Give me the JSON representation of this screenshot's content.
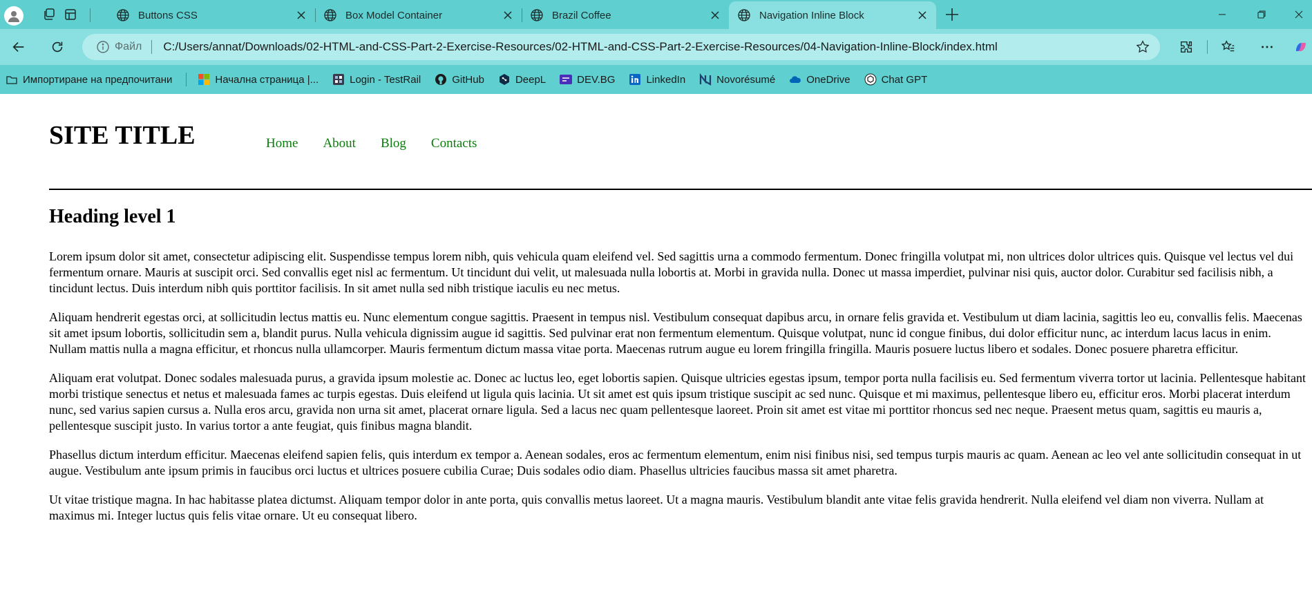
{
  "browser": {
    "tabs": [
      {
        "title": "Buttons CSS",
        "active": false
      },
      {
        "title": "Box Model Container",
        "active": false
      },
      {
        "title": "Brazil Coffee",
        "active": false
      },
      {
        "title": "Navigation Inline Block",
        "active": true
      }
    ],
    "address": {
      "file_label": "Файл",
      "url": "C:/Users/annat/Downloads/02-HTML-and-CSS-Part-2-Exercise-Resources/02-HTML-and-CSS-Part-2-Exercise-Resources/04-Navigation-Inline-Block/index.html"
    },
    "bookmarks": [
      {
        "label": "Импортиране на предпочитани",
        "icon": "folder-icon"
      },
      {
        "label": "Начална страница |...",
        "icon": "windows-icon"
      },
      {
        "label": "Login - TestRail",
        "icon": "testrail-icon"
      },
      {
        "label": "GitHub",
        "icon": "github-icon"
      },
      {
        "label": "DeepL",
        "icon": "deepl-icon"
      },
      {
        "label": "DEV.BG",
        "icon": "devbg-icon"
      },
      {
        "label": "LinkedIn",
        "icon": "linkedin-icon"
      },
      {
        "label": "Novorésumé",
        "icon": "novoresume-icon"
      },
      {
        "label": "OneDrive",
        "icon": "onedrive-icon"
      },
      {
        "label": "Chat GPT",
        "icon": "chatgpt-icon"
      }
    ],
    "colors": {
      "chrome": "#5fcfcf",
      "active_tab": "#8ae0e0",
      "address_bar": "#b3ecec"
    }
  },
  "page": {
    "site_title": "SITE TITLE",
    "nav": [
      "Home",
      "About",
      "Blog",
      "Contacts"
    ],
    "heading": "Heading level 1",
    "paragraphs": [
      "Lorem ipsum dolor sit amet, consectetur adipiscing elit. Suspendisse tempus lorem nibh, quis vehicula quam eleifend vel. Sed sagittis urna a commodo fermentum. Donec fringilla volutpat mi, non ultrices dolor ultrices quis. Quisque vel lectus vel dui fermentum ornare. Mauris at suscipit orci. Sed convallis eget nisl ac fermentum. Ut tincidunt dui velit, ut malesuada nulla lobortis at. Morbi in gravida nulla. Donec ut massa imperdiet, pulvinar nisi quis, auctor dolor. Curabitur sed facilisis nibh, a tincidunt lectus. Duis interdum nibh quis porttitor facilisis. In sit amet nulla sed nibh tristique iaculis eu nec metus.",
      "Aliquam hendrerit egestas orci, at sollicitudin lectus mattis eu. Nunc elementum congue sagittis. Praesent in tempus nisl. Vestibulum consequat dapibus arcu, in ornare felis gravida et. Vestibulum ut diam lacinia, sagittis leo eu, convallis felis. Maecenas sit amet ipsum lobortis, sollicitudin sem a, blandit purus. Nulla vehicula dignissim augue id sagittis. Sed pulvinar erat non fermentum elementum. Quisque volutpat, nunc id congue finibus, dui dolor efficitur nunc, ac interdum lacus lacus in enim. Nullam mattis nulla a magna efficitur, et rhoncus nulla ullamcorper. Mauris fermentum dictum massa vitae porta. Maecenas rutrum augue eu lorem fringilla fringilla. Mauris posuere luctus libero et sodales. Donec posuere pharetra efficitur.",
      "Aliquam erat volutpat. Donec sodales malesuada purus, a gravida ipsum molestie ac. Donec ac luctus leo, eget lobortis sapien. Quisque ultricies egestas ipsum, tempor porta nulla facilisis eu. Sed fermentum viverra tortor ut lacinia. Pellentesque habitant morbi tristique senectus et netus et malesuada fames ac turpis egestas. Duis eleifend ut ligula quis lacinia. Ut sit amet est quis ipsum tristique suscipit ac sed nunc. Quisque et mi maximus, pellentesque libero eu, efficitur eros. Morbi placerat interdum nunc, sed varius sapien cursus a. Nulla eros arcu, gravida non urna sit amet, placerat ornare ligula. Sed a lacus nec quam pellentesque laoreet. Proin sit amet est vitae mi porttitor rhoncus sed nec neque. Praesent metus quam, sagittis eu mauris a, pellentesque suscipit justo. In varius tortor a ante feugiat, quis finibus magna blandit.",
      "Phasellus dictum interdum efficitur. Maecenas eleifend sapien felis, quis interdum ex tempor a. Aenean sodales, eros ac fermentum elementum, enim nisi finibus nisi, sed tempus turpis mauris ac quam. Aenean ac leo vel ante sollicitudin consequat in ut augue. Vestibulum ante ipsum primis in faucibus orci luctus et ultrices posuere cubilia Curae; Duis sodales odio diam. Phasellus ultricies faucibus massa sit amet pharetra.",
      "Ut vitae tristique magna. In hac habitasse platea dictumst. Aliquam tempor dolor in ante porta, quis convallis metus laoreet. Ut a magna mauris. Vestibulum blandit ante vitae felis gravida hendrerit. Nulla eleifend vel diam non viverra. Nullam at maximus mi. Integer luctus quis felis vitae ornare. Ut eu consequat libero."
    ],
    "colors": {
      "nav_link": "#0c7c0c",
      "text": "#000000"
    }
  }
}
